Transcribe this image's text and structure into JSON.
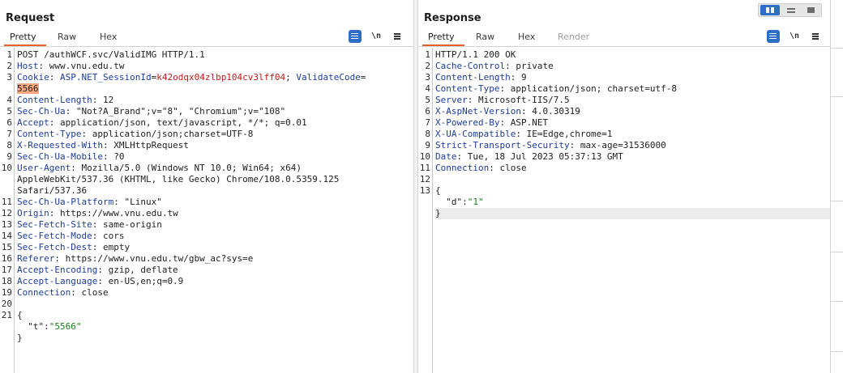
{
  "request": {
    "title": "Request",
    "tabs": [
      "Pretty",
      "Raw",
      "Hex"
    ],
    "active_tab": "Pretty",
    "icons": [
      "wrap-lines-icon",
      "newline-icon",
      "menu-icon"
    ],
    "newline_label": "\\n",
    "line_numbers": [
      "1",
      "2",
      "3",
      "",
      "4",
      "5",
      "6",
      "7",
      "8",
      "9",
      "10",
      "",
      "",
      "11",
      "12",
      "13",
      "14",
      "15",
      "16",
      "17",
      "18",
      "19",
      "20",
      "21",
      "",
      "",
      ""
    ],
    "lines": {
      "l1": "POST /authWCF.svc/ValidIMG HTTP/1.1",
      "l2_k": "Host",
      "l2_v": " www.vnu.edu.tw",
      "l3_k": "Cookie",
      "l3_c1k": "ASP.NET_SessionId",
      "l3_c1v": "k42odqx04zlbp104cv3lff04",
      "l3_c2k": "ValidateCode",
      "l3b": "5566",
      "l4_k": "Content-Length",
      "l4_v": " 12",
      "l5_k": "Sec-Ch-Ua",
      "l5_v": " \"Not?A_Brand\";v=\"8\", \"Chromium\";v=\"108\"",
      "l6_k": "Accept",
      "l6_v": " application/json, text/javascript, */*; q=0.01",
      "l7_k": "Content-Type",
      "l7_v": " application/json;charset=UTF-8",
      "l8_k": "X-Requested-With",
      "l8_v": " XMLHttpRequest",
      "l9_k": "Sec-Ch-Ua-Mobile",
      "l9_v": " ?0",
      "l10_k": "User-Agent",
      "l10_v": " Mozilla/5.0 (Windows NT 10.0; Win64; x64)",
      "l10b": "AppleWebKit/537.36 (KHTML, like Gecko) Chrome/108.0.5359.125",
      "l10c": "Safari/537.36",
      "l11_k": "Sec-Ch-Ua-Platform",
      "l11_v": " \"Linux\"",
      "l12_k": "Origin",
      "l12_v": " https://www.vnu.edu.tw",
      "l13_k": "Sec-Fetch-Site",
      "l13_v": " same-origin",
      "l14_k": "Sec-Fetch-Mode",
      "l14_v": " cors",
      "l15_k": "Sec-Fetch-Dest",
      "l15_v": " empty",
      "l16_k": "Referer",
      "l16_v": " https://www.vnu.edu.tw/gbw_ac?sys=e",
      "l17_k": "Accept-Encoding",
      "l17_v": " gzip, deflate",
      "l18_k": "Accept-Language",
      "l18_v": " en-US,en;q=0.9",
      "l19_k": "Connection",
      "l19_v": " close",
      "l21": "{",
      "l22_k": "\"t\"",
      "l22_v": "\"5566\"",
      "l23": "}"
    }
  },
  "response": {
    "title": "Response",
    "tabs": [
      "Pretty",
      "Raw",
      "Hex",
      "Render"
    ],
    "active_tab": "Pretty",
    "icons": [
      "wrap-lines-icon",
      "newline-icon",
      "menu-icon"
    ],
    "newline_label": "\\n",
    "line_numbers": [
      "1",
      "2",
      "3",
      "4",
      "5",
      "6",
      "7",
      "8",
      "9",
      "10",
      "11",
      "12",
      "13",
      "",
      ""
    ],
    "lines": {
      "l1": "HTTP/1.1 200 OK",
      "l2_k": "Cache-Control",
      "l2_v": " private",
      "l3_k": "Content-Length",
      "l3_v": " 9",
      "l4_k": "Content-Type",
      "l4_v": " application/json; charset=utf-8",
      "l5_k": "Server",
      "l5_v": " Microsoft-IIS/7.5",
      "l6_k": "X-AspNet-Version",
      "l6_v": " 4.0.30319",
      "l7_k": "X-Powered-By",
      "l7_v": " ASP.NET",
      "l8_k": "X-UA-Compatible",
      "l8_v": " IE=Edge,chrome=1",
      "l9_k": "Strict-Transport-Security",
      "l9_v": " max-age=31536000",
      "l10_k": "Date",
      "l10_v": " Tue, 18 Jul 2023 05:37:13 GMT",
      "l11_k": "Connection",
      "l11_v": " close",
      "l13": "{",
      "l14_k": "\"d\"",
      "l14_v": "\"1\"",
      "l15": "}"
    }
  },
  "view_switch": [
    "side-by-side-view-icon",
    "horizontal-split-view-icon",
    "single-pane-view-icon"
  ],
  "colors": {
    "accent_orange": "#e8602c",
    "header_key_blue": "#1d3d9a",
    "cookie_value_red": "#c41a16",
    "string_green": "#1c7c1c",
    "button_blue": "#2d6fc6",
    "highlight_bg": "#f6a880"
  }
}
